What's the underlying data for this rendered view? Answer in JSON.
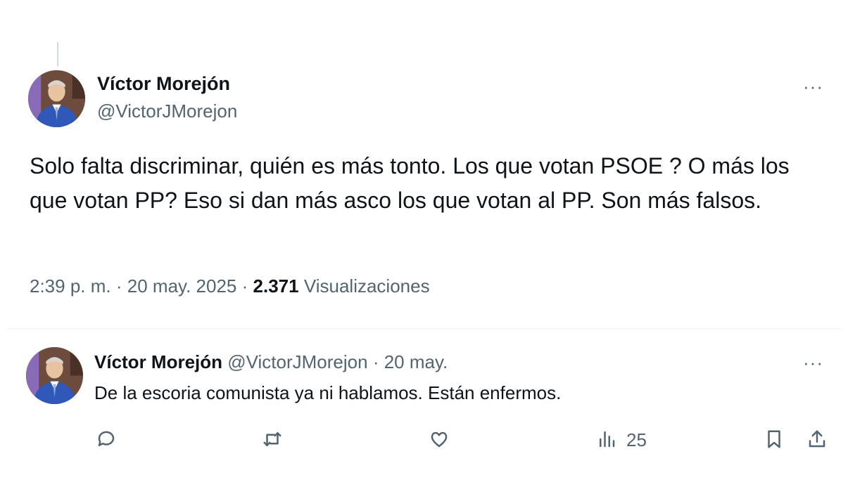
{
  "main_tweet": {
    "author_name": "Víctor Morejón",
    "author_handle": "@VictorJMorejon",
    "text": "Solo falta discriminar, quién es más tonto. Los que votan PSOE ? O más los que votan PP? Eso si dan más asco los que votan al PP. Son más falsos.",
    "time": "2:39 p. m.",
    "date": "20 may. 2025",
    "views_count": "2.371",
    "views_label": "Visualizaciones",
    "separator": "·",
    "more_label": "···"
  },
  "reply_tweet": {
    "author_name": "Víctor Morejón",
    "author_handle": "@VictorJMorejon",
    "date": "· 20 may.",
    "text": "De la escoria comunista ya ni hablamos. Están enfermos.",
    "more_label": "···",
    "actions": {
      "reply_icon": "reply-icon",
      "retweet_icon": "retweet-icon",
      "like_icon": "like-icon",
      "views_icon": "views-icon",
      "views_count": "25",
      "bookmark_icon": "bookmark-icon",
      "share_icon": "share-icon"
    }
  },
  "colors": {
    "text_primary": "#0f1419",
    "text_secondary": "#536471",
    "divider": "#eff3f4"
  }
}
